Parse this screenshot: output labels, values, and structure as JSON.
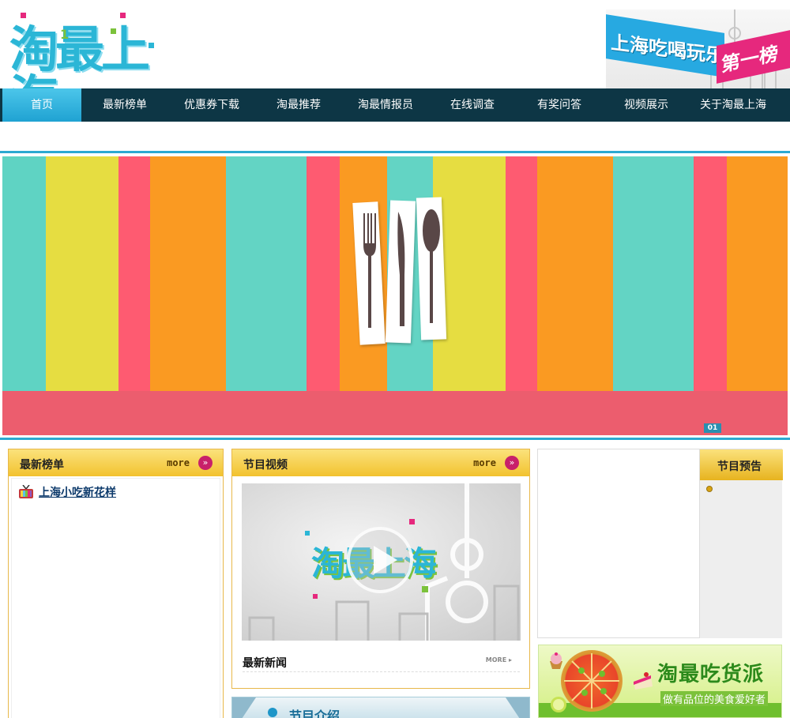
{
  "header": {
    "logo_text": "淘最上海",
    "logo_badge": "1",
    "banner_main": "上海吃喝玩乐",
    "banner_rank": "第一榜"
  },
  "nav": {
    "items": [
      "首页",
      "最新榜单",
      "优惠券下载",
      "淘最推荐",
      "淘最情报员",
      "在线调查",
      "有奖问答",
      "视频展示",
      "关于淘最上海"
    ],
    "active_index": 0
  },
  "slider": {
    "current": "01",
    "stripe_colors": [
      "#5fd3c3",
      "#e6dd41",
      "#fe5b71",
      "#fa9a22",
      "#63d4c4",
      "#fe5b71",
      "#fa9a22",
      "#63d4c4",
      "#e6dd41",
      "#fe5b71",
      "#fa9a22",
      "#63d4c4",
      "#fe5b71",
      "#fa9a22"
    ]
  },
  "panels": {
    "ranking": {
      "title": "最新榜单",
      "more": "more",
      "items": [
        "上海小吃新花样"
      ]
    },
    "videos": {
      "title": "节目视频",
      "more": "more",
      "video_logo": "淘最上海",
      "news_title": "最新新闻",
      "news_more": "MORE"
    },
    "intro": {
      "title": "节目介绍"
    },
    "preview": {
      "title": "节目预告"
    }
  },
  "ad": {
    "title": "淘最吃货派",
    "subtitle": "做有品位的美食爱好者"
  },
  "colors": {
    "nav_bg": "#0d3645",
    "nav_active": "#2bb0dc",
    "panel_head": "#f4c83a",
    "accent_blue": "#2ca9d1"
  }
}
